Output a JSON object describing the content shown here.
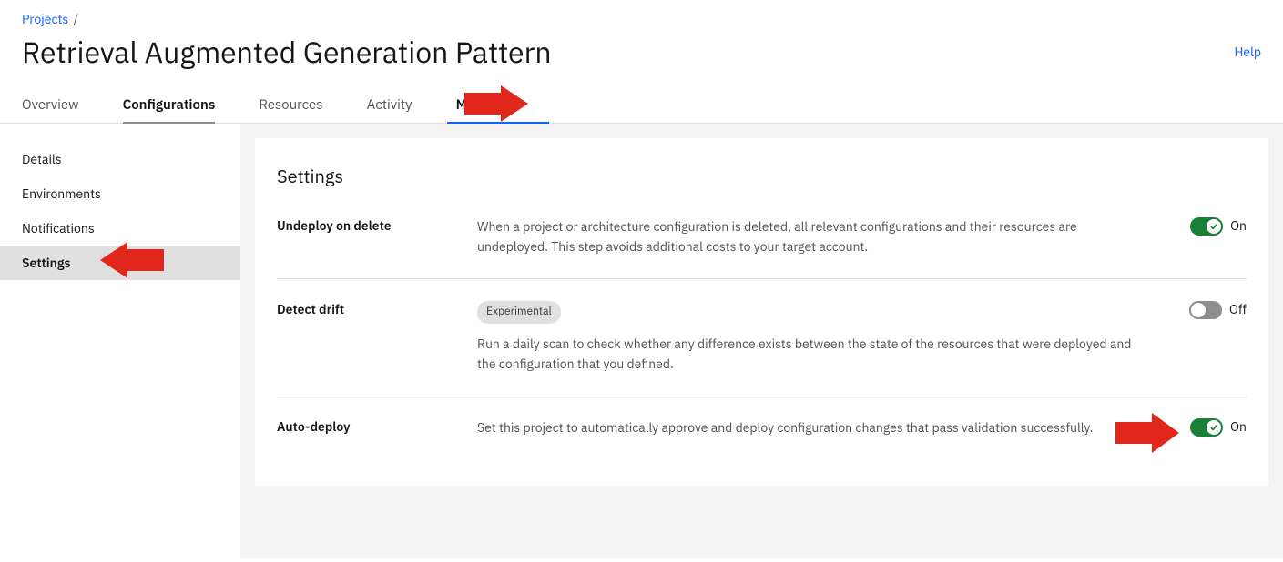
{
  "breadcrumb": {
    "root": "Projects"
  },
  "page_title": "Retrieval Augmented Generation Pattern",
  "help": "Help",
  "tabs": {
    "overview": "Overview",
    "configurations": "Configurations",
    "resources": "Resources",
    "activity": "Activity",
    "manage": "Manage"
  },
  "sidebar": {
    "details": "Details",
    "environments": "Environments",
    "notifications": "Notifications",
    "settings": "Settings"
  },
  "panel": {
    "heading": "Settings",
    "undeploy": {
      "label": "Undeploy on delete",
      "desc": "When a project or architecture configuration is deleted, all relevant configurations and their resources are undeployed. This step avoids additional costs to your target account.",
      "state": "On"
    },
    "drift": {
      "label": "Detect drift",
      "badge": "Experimental",
      "desc": "Run a daily scan to check whether any difference exists between the state of the resources that were deployed and the configuration that you defined.",
      "state": "Off"
    },
    "autodeploy": {
      "label": "Auto-deploy",
      "desc": "Set this project to automatically approve and deploy configuration changes that pass validation successfully.",
      "state": "On"
    }
  }
}
